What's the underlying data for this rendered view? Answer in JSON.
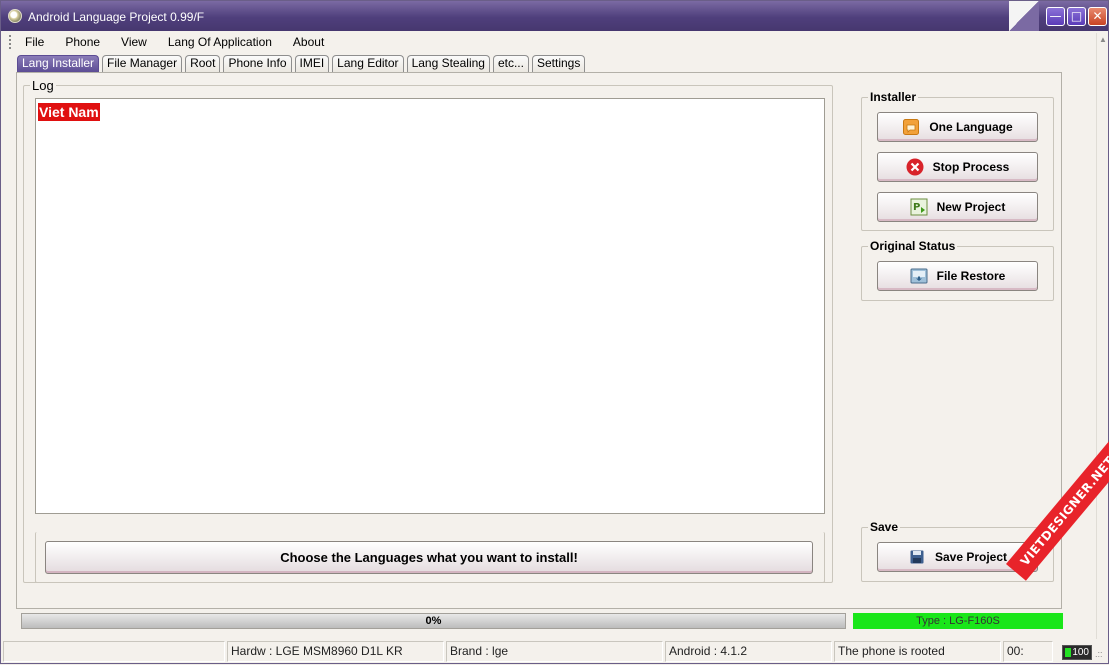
{
  "window": {
    "title": "Android Language Project 0.99/F"
  },
  "menu": [
    "File",
    "Phone",
    "View",
    "Lang Of Application",
    "About"
  ],
  "tabs": [
    "Lang Installer",
    "File Manager",
    "Root",
    "Phone Info",
    "IMEI",
    "Lang Editor",
    "Lang Stealing",
    "etc...",
    "Settings"
  ],
  "active_tab": "Lang Installer",
  "log": {
    "legend": "Log",
    "entries": [
      "Viet Nam"
    ]
  },
  "installer": {
    "legend": "Installer",
    "buttons": {
      "one_language": "One Language",
      "stop_process": "Stop Process",
      "new_project": "New Project"
    }
  },
  "original_status": {
    "legend": "Original Status",
    "file_restore": "File Restore"
  },
  "save": {
    "legend": "Save",
    "save_project": "Save Project"
  },
  "choose_button": "Choose the Languages what you want to install!",
  "progress": {
    "label": "0%",
    "value": 0
  },
  "type_label": "Type : LG-F160S",
  "status": {
    "hardware": "Hardw : LGE MSM8960 D1L KR",
    "brand": "Brand : lge",
    "android": "Android : 4.1.2",
    "root_status": "The phone is rooted",
    "time": "00:",
    "battery": "100"
  },
  "watermark": "VIETDESIGNER.NET",
  "colors": {
    "titlebar": "#4f3f7c",
    "active_tab": "#5c4c94",
    "log_highlight": "#e01010",
    "type_bar": "#19e619",
    "watermark": "#e8232a"
  }
}
